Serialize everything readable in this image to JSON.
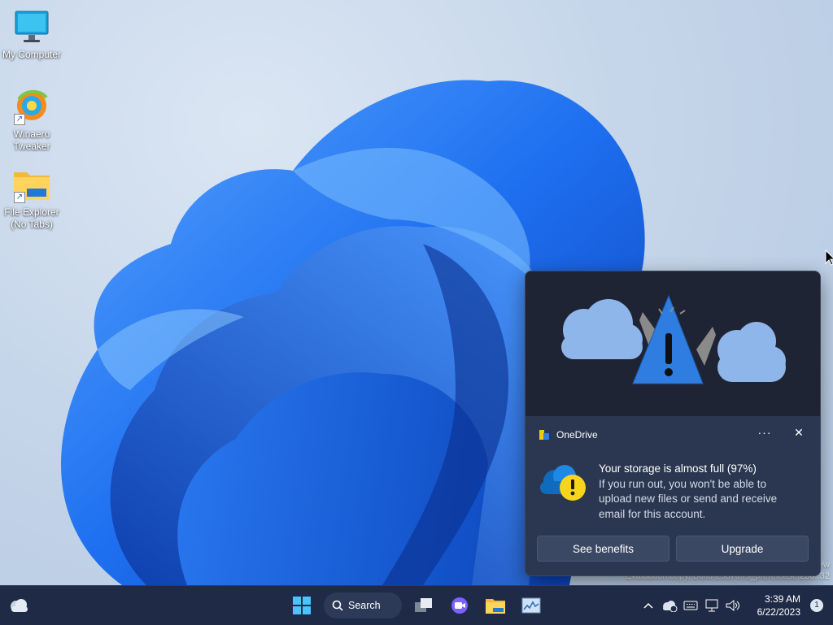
{
  "desktop": {
    "icons": [
      {
        "label": "My Computer",
        "icon": "monitor-icon"
      },
      {
        "label": "Winaero\nTweaker",
        "icon": "winaero-tweaker-icon"
      },
      {
        "label": "File Explorer\n(No Tabs)",
        "icon": "folder-icon"
      }
    ],
    "watermark": {
      "line1": "ew",
      "line2": "Evaluation copy. Build 25370.rs_prerelease.230..32"
    }
  },
  "toast": {
    "app_name": "OneDrive",
    "more_label": "···",
    "close_label": "✕",
    "title": "Your storage is almost full (97%)",
    "message": "If you run out, you won't be able to upload new files or send and receive email for this account.",
    "actions": [
      "See benefits",
      "Upgrade"
    ],
    "hero_icon": "cloud-warning-illustration",
    "colors": {
      "accent": "#2f7de0",
      "warning": "#f7d51d",
      "background": "#2b3750"
    }
  },
  "taskbar": {
    "search_label": "Search",
    "apps": [
      "start-icon",
      "task-view-icon",
      "teams-chat-icon",
      "file-explorer-icon",
      "task-manager-icon"
    ],
    "tray": {
      "icons": [
        "chevron-up-icon",
        "onedrive-icon",
        "keyboard-icon",
        "network-icon",
        "volume-icon"
      ],
      "time": "3:39 AM",
      "date": "6/22/2023",
      "notification_count": "1"
    }
  }
}
